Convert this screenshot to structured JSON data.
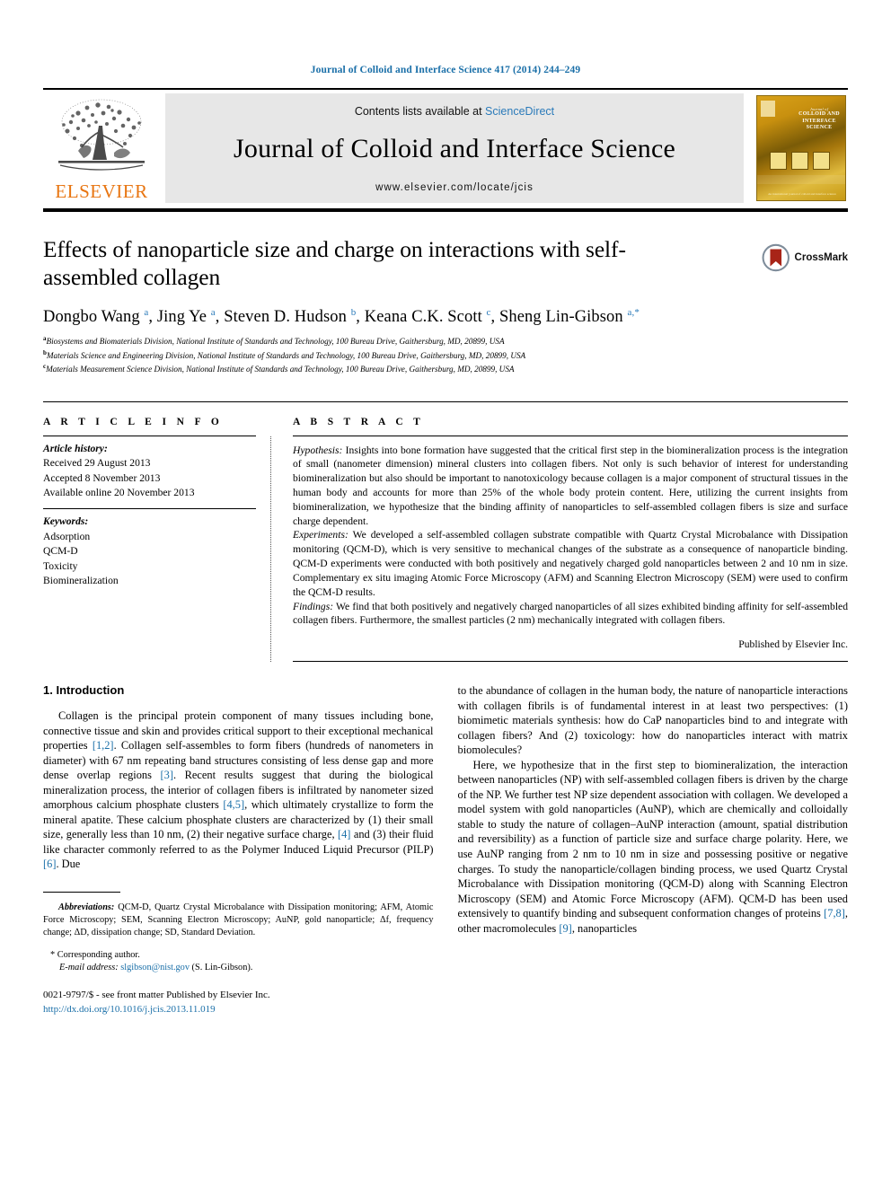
{
  "running_head": "Journal of Colloid and Interface Science 417 (2014) 244–249",
  "masthead": {
    "publisher_name": "ELSEVIER",
    "contents_prefix": "Contents lists available at",
    "contents_link": "ScienceDirect",
    "journal_title": "Journal of Colloid and Interface Science",
    "journal_url": "www.elsevier.com/locate/jcis",
    "cover": {
      "line_journal": "Journal of",
      "line1": "COLLOID AND",
      "line2": "INTERFACE",
      "line3": "SCIENCE",
      "footer": "An international journal of colloid and interface science",
      "footer2": "www.elsevier.com/locate/jcis"
    }
  },
  "article": {
    "title": "Effects of nanoparticle size and charge on interactions with self-assembled collagen",
    "crossmark_label": "CrossMark",
    "authors_html": "Dongbo Wang <sup>a</sup>, Jing Ye <sup>a</sup>, Steven D. Hudson <sup>b</sup>, Keana C.K. Scott <sup>c</sup>, Sheng Lin-Gibson <sup>a,</sup><sup>*</sup>",
    "affiliations": [
      {
        "mark": "a",
        "text": "Biosystems and Biomaterials Division, National Institute of Standards and Technology, 100 Bureau Drive, Gaithersburg, MD, 20899, USA"
      },
      {
        "mark": "b",
        "text": "Materials Science and Engineering Division, National Institute of Standards and Technology, 100 Bureau Drive, Gaithersburg, MD, 20899, USA"
      },
      {
        "mark": "c",
        "text": "Materials Measurement Science Division, National Institute of Standards and Technology, 100 Bureau Drive, Gaithersburg, MD, 20899, USA"
      }
    ]
  },
  "article_info": {
    "heading": "A R T I C L E  I N F O",
    "history_label": "Article history:",
    "history": [
      "Received 29 August 2013",
      "Accepted 8 November 2013",
      "Available online 20 November 2013"
    ],
    "keywords_label": "Keywords:",
    "keywords": [
      "Adsorption",
      "QCM-D",
      "Toxicity",
      "Biomineralization"
    ]
  },
  "abstract": {
    "heading": "A B S T R A C T",
    "paragraphs": [
      {
        "runin": "Hypothesis:",
        "text": " Insights into bone formation have suggested that the critical first step in the biomineralization process is the integration of small (nanometer dimension) mineral clusters into collagen fibers. Not only is such behavior of interest for understanding biomineralization but also should be important to nanotoxicology because collagen is a major component of structural tissues in the human body and accounts for more than 25% of the whole body protein content. Here, utilizing the current insights from biomineralization, we hypothesize that the binding affinity of nanoparticles to self-assembled collagen fibers is size and surface charge dependent."
      },
      {
        "runin": "Experiments:",
        "text": " We developed a self-assembled collagen substrate compatible with Quartz Crystal Microbalance with Dissipation monitoring (QCM-D), which is very sensitive to mechanical changes of the substrate as a consequence of nanoparticle binding. QCM-D experiments were conducted with both positively and negatively charged gold nanoparticles between 2 and 10 nm in size. Complementary ex situ imaging Atomic Force Microscopy (AFM) and Scanning Electron Microscopy (SEM) were used to confirm the QCM-D results."
      },
      {
        "runin": "Findings:",
        "text": " We find that both positively and negatively charged nanoparticles of all sizes exhibited binding affinity for self-assembled collagen fibers. Furthermore, the smallest particles (2 nm) mechanically integrated with collagen fibers."
      }
    ],
    "published_by": "Published by Elsevier Inc."
  },
  "body": {
    "section_title": "1. Introduction",
    "left_paragraph_1": "Collagen is the principal protein component of many tissues including bone, connective tissue and skin and provides critical support to their exceptional mechanical properties [1,2]. Collagen self-assembles to form fibers (hundreds of nanometers in diameter) with 67 nm repeating band structures consisting of less dense gap and more dense overlap regions [3]. Recent results suggest that during the biological mineralization process, the interior of collagen fibers is infiltrated by nanometer sized amorphous calcium phosphate clusters [4,5], which ultimately crystallize to form the mineral apatite. These calcium phosphate clusters are characterized by (1) their small size, generally less than 10 nm, (2) their negative surface charge, [4] and (3) their fluid like character commonly referred to as the Polymer Induced Liquid Precursor (PILP) [6]. Due",
    "right_paragraph_1": "to the abundance of collagen in the human body, the nature of nanoparticle interactions with collagen fibrils is of fundamental interest in at least two perspectives: (1) biomimetic materials synthesis: how do CaP nanoparticles bind to and integrate with collagen fibers? And (2) toxicology: how do nanoparticles interact with matrix biomolecules?",
    "right_paragraph_2": "Here, we hypothesize that in the first step to biomineralization, the interaction between nanoparticles (NP) with self-assembled collagen fibers is driven by the charge of the NP. We further test NP size dependent association with collagen. We developed a model system with gold nanoparticles (AuNP), which are chemically and colloidally stable to study the nature of collagen–AuNP interaction (amount, spatial distribution and reversibility) as a function of particle size and surface charge polarity. Here, we use AuNP ranging from 2 nm to 10 nm in size and possessing positive or negative charges. To study the nanoparticle/collagen binding process, we used Quartz Crystal Microbalance with Dissipation monitoring (QCM-D) along with Scanning Electron Microscopy (SEM) and Atomic Force Microscopy (AFM). QCM-D has been used extensively to quantify binding and subsequent conformation changes of proteins [7,8], other macromolecules [9], nanoparticles",
    "footnote_abbrev_label": "Abbreviations:",
    "footnote_abbrev": " QCM-D, Quartz Crystal Microbalance with Dissipation monitoring; AFM, Atomic Force Microscopy; SEM, Scanning Electron Microscopy; AuNP, gold nanoparticle; Δf, frequency change; ΔD, dissipation change; SD, Standard Deviation.",
    "corresponding_author": "* Corresponding author.",
    "email_label": "E-mail address:",
    "email": "slgibson@nist.gov",
    "email_suffix": " (S. Lin-Gibson).",
    "imprint": "0021-9797/$ - see front matter Published by Elsevier Inc.",
    "doi": "http://dx.doi.org/10.1016/j.jcis.2013.11.019"
  },
  "colors": {
    "link": "#1a6fa8",
    "sciencedirect": "#2a7ab9",
    "elsevier_orange": "#E87511",
    "masthead_bg": "#e7e7e7"
  }
}
